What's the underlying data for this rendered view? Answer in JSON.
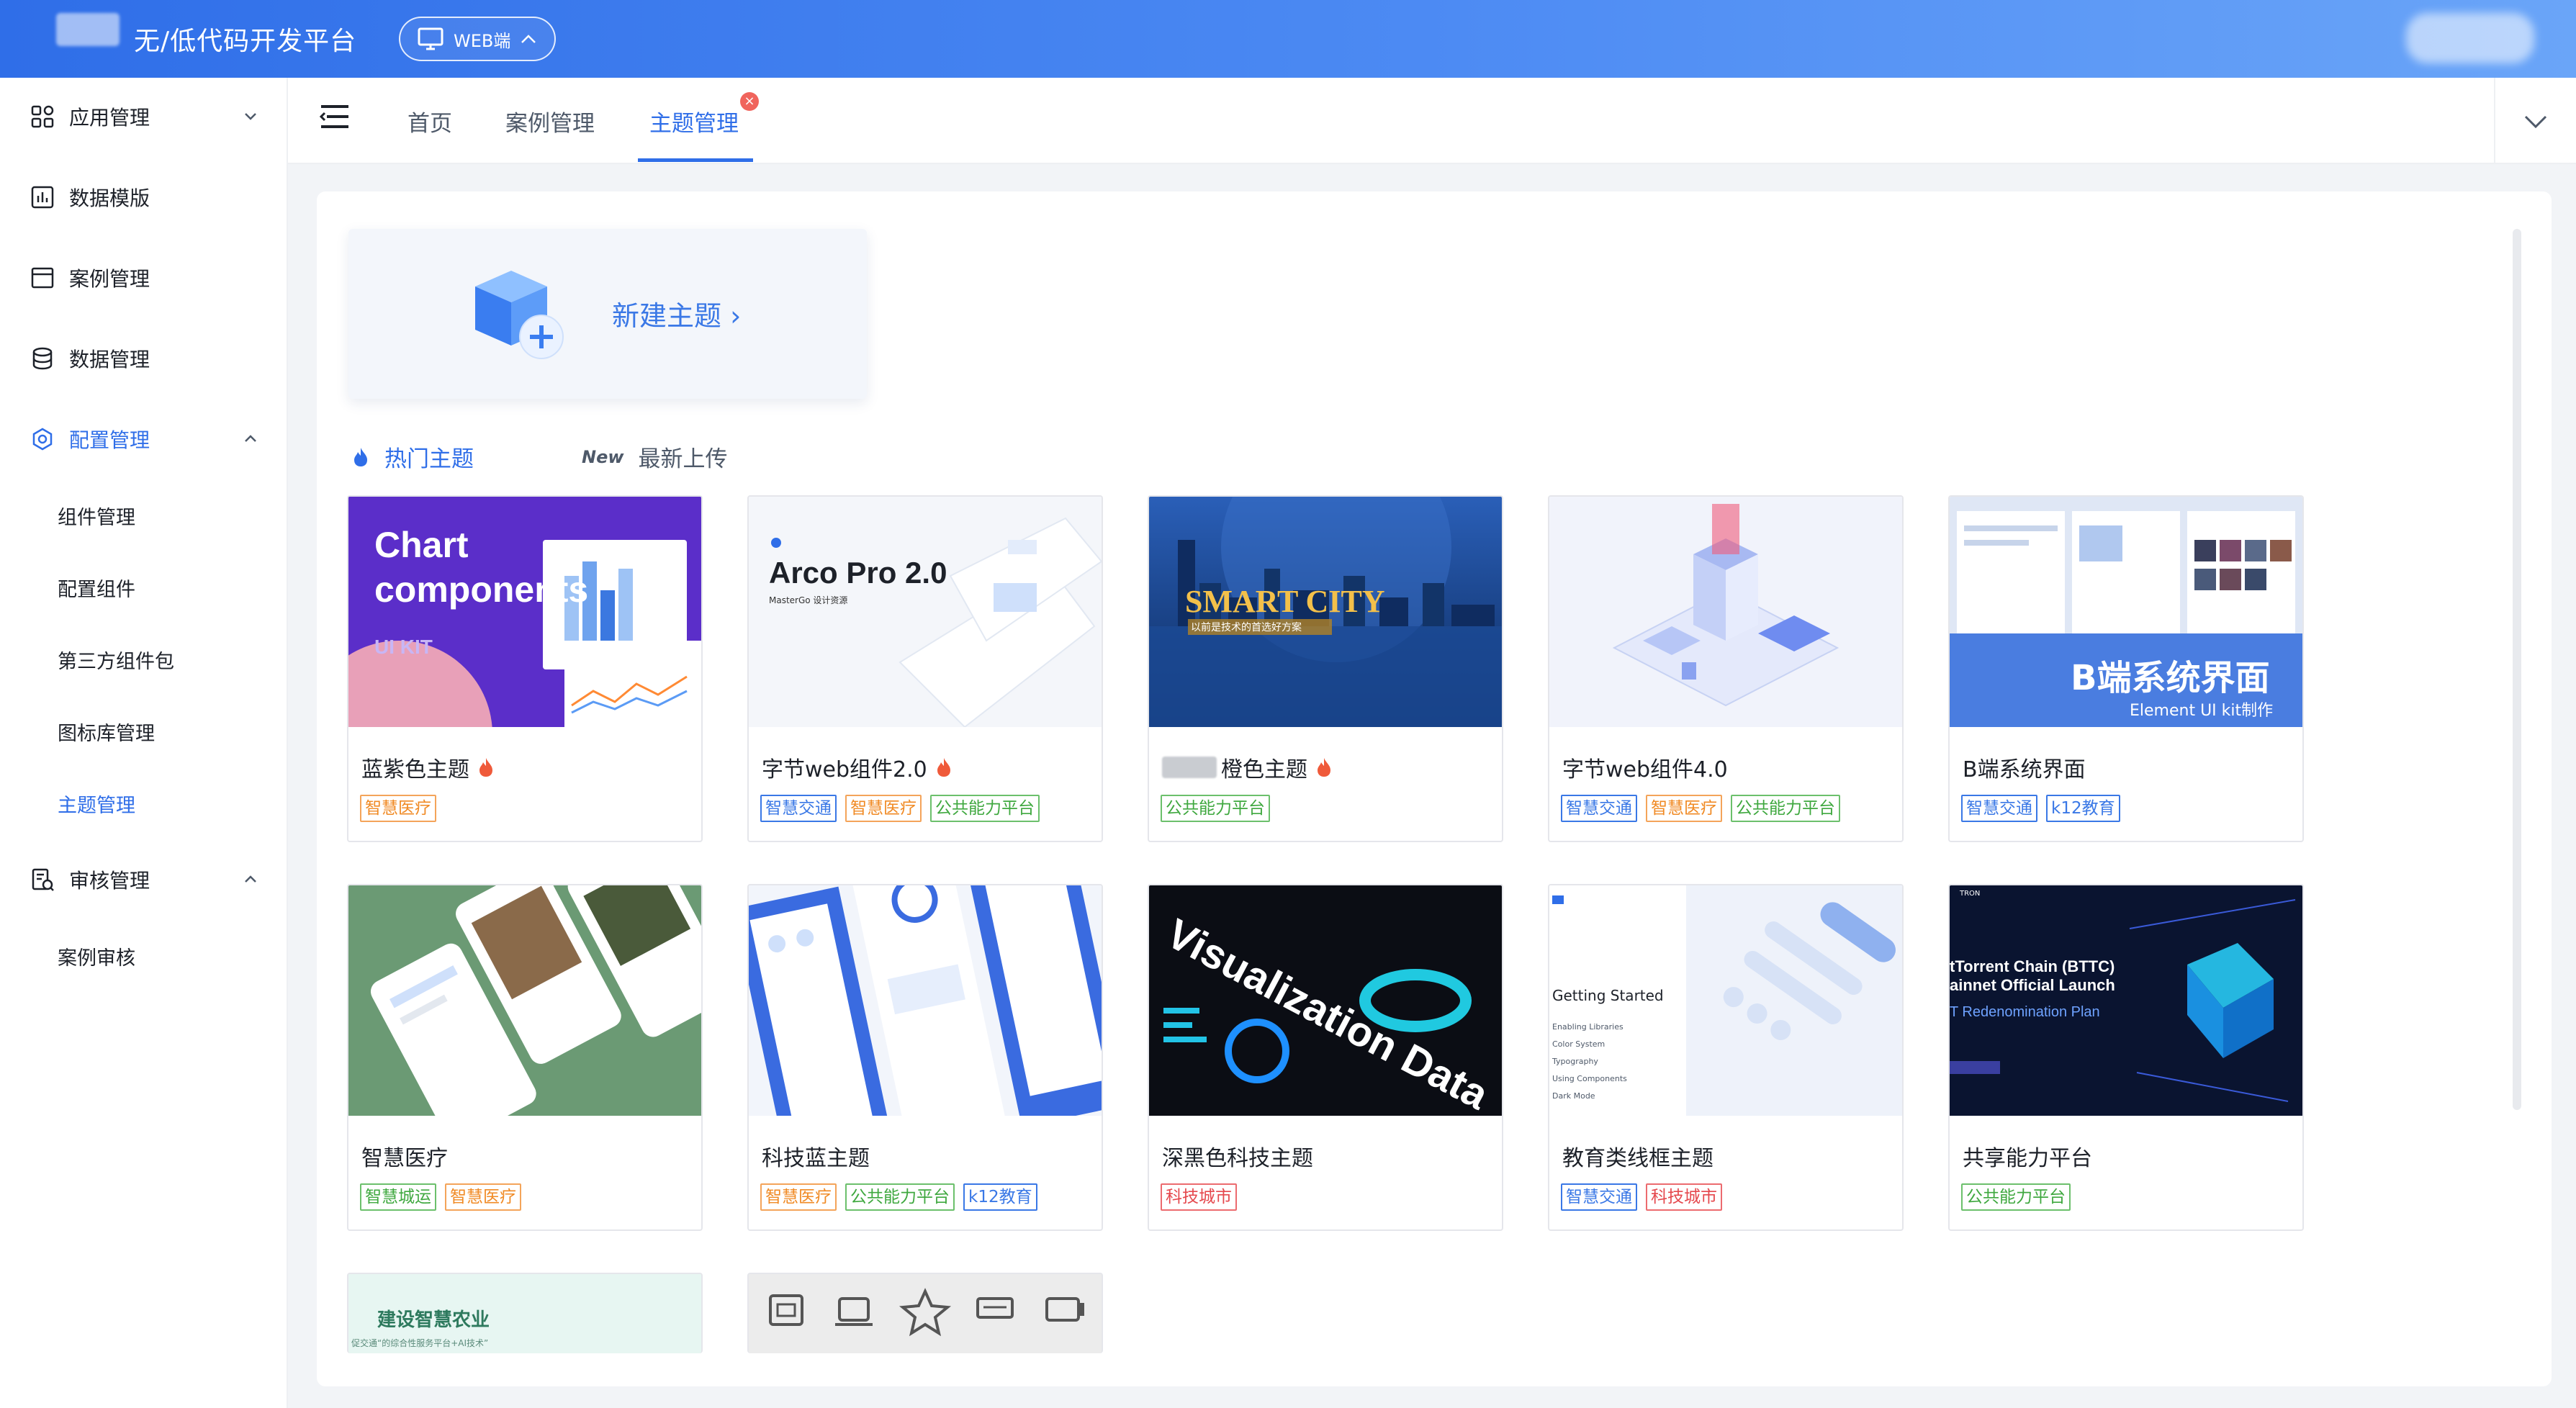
{
  "header": {
    "title": "无/低代码开发平台",
    "platform_label": "WEB端"
  },
  "sidebar": {
    "items": [
      {
        "label": "应用管理"
      },
      {
        "label": "数据模版"
      },
      {
        "label": "案例管理"
      },
      {
        "label": "数据管理"
      },
      {
        "label": "配置管理"
      },
      {
        "label": "审核管理"
      }
    ],
    "config_sub": [
      "组件管理",
      "配置组件",
      "第三方组件包",
      "图标库管理",
      "主题管理"
    ],
    "review_sub": [
      "案例审核"
    ]
  },
  "tabs": [
    "首页",
    "案例管理",
    "主题管理"
  ],
  "new_theme": {
    "label": "新建主题 ›"
  },
  "filters": {
    "hot": "热门主题",
    "new_badge": "New",
    "latest": "最新上传"
  },
  "cards": [
    {
      "name": "蓝紫色主题",
      "hot": true,
      "tags": [
        {
          "text": "智慧医疗",
          "color": "orange"
        }
      ],
      "thumb_text": {
        "t1": "Chart",
        "t2": "components",
        "t3": "UI KIT"
      }
    },
    {
      "name": "字节web组件2.0",
      "hot": true,
      "tags": [
        {
          "text": "智慧交通",
          "color": "blue"
        },
        {
          "text": "智慧医疗",
          "color": "orange"
        },
        {
          "text": "公共能力平台",
          "color": "green"
        }
      ],
      "thumb_text": {
        "t1": "Arco Pro 2.0",
        "t2": "MasterGo 设计资源"
      }
    },
    {
      "name": "橙色主题",
      "hot": true,
      "tags": [
        {
          "text": "公共能力平台",
          "color": "green"
        }
      ],
      "thumb_text": {
        "t1": "SMART CITY",
        "t2": "以前是技术的首选好方案"
      }
    },
    {
      "name": "字节web组件4.0",
      "hot": false,
      "tags": [
        {
          "text": "智慧交通",
          "color": "blue"
        },
        {
          "text": "智慧医疗",
          "color": "orange"
        },
        {
          "text": "公共能力平台",
          "color": "green"
        }
      ]
    },
    {
      "name": "B端系统界面",
      "hot": false,
      "tags": [
        {
          "text": "智慧交通",
          "color": "blue"
        },
        {
          "text": "k12教育",
          "color": "blue"
        }
      ],
      "thumb_text": {
        "t1": "B端系统界面",
        "t2": "Element UI kit制作"
      }
    },
    {
      "name": "智慧医疗",
      "hot": false,
      "tags": [
        {
          "text": "智慧城运",
          "color": "green"
        },
        {
          "text": "智慧医疗",
          "color": "orange"
        }
      ]
    },
    {
      "name": "科技蓝主题",
      "hot": false,
      "tags": [
        {
          "text": "智慧医疗",
          "color": "orange"
        },
        {
          "text": "公共能力平台",
          "color": "green"
        },
        {
          "text": "k12教育",
          "color": "blue"
        }
      ]
    },
    {
      "name": "深黑色科技主题",
      "hot": false,
      "tags": [
        {
          "text": "科技城市",
          "color": "red"
        }
      ],
      "thumb_text": {
        "t1": "Visualization Data"
      }
    },
    {
      "name": "教育类线框主题",
      "hot": false,
      "tags": [
        {
          "text": "智慧交通",
          "color": "blue"
        },
        {
          "text": "科技城市",
          "color": "red"
        }
      ],
      "thumb_text": {
        "t1": "Getting Started",
        "t2": "Enabling Libraries",
        "t3": "Color System",
        "t4": "Typography",
        "t5": "Using Components",
        "t6": "Dark Mode"
      }
    },
    {
      "name": "共享能力平台",
      "hot": false,
      "tags": [
        {
          "text": "公共能力平台",
          "color": "green"
        }
      ],
      "thumb_text": {
        "t1": "tTorrent Chain (BTTC)",
        "t2": "ainnet Official Launch",
        "t3": "T Redenomination Plan",
        "t4": "TRON"
      }
    },
    {
      "name": "",
      "hot": false,
      "tags": [],
      "thumb_text": {
        "t1": "建设智慧农业",
        "t2": "促交通“的综合性服务平台+AI技术”"
      }
    },
    {
      "name": "",
      "hot": false,
      "tags": []
    }
  ],
  "colors": {
    "primary": "#2f6ee8",
    "header_start": "#2f6ee8",
    "header_end": "#6aa5f8",
    "tag_orange": "#f08a24",
    "tag_green": "#3fa83f",
    "tag_red": "#e5484d"
  }
}
